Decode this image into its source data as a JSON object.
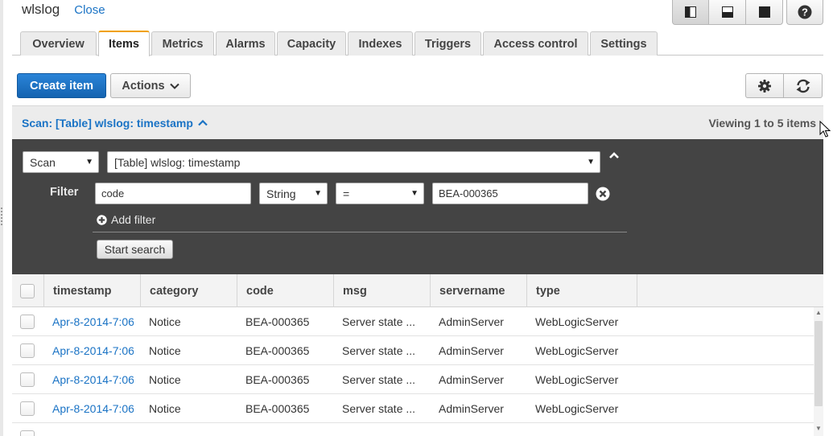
{
  "header": {
    "table_name": "wlslog",
    "close_label": "Close",
    "view_buttons": [
      {
        "name": "split-left-view-icon",
        "active": true
      },
      {
        "name": "split-bottom-view-icon",
        "active": false
      },
      {
        "name": "full-view-icon",
        "active": false
      }
    ],
    "help_icon": "help-icon"
  },
  "tabs": [
    {
      "label": "Overview",
      "active": false
    },
    {
      "label": "Items",
      "active": true
    },
    {
      "label": "Metrics",
      "active": false
    },
    {
      "label": "Alarms",
      "active": false
    },
    {
      "label": "Capacity",
      "active": false
    },
    {
      "label": "Indexes",
      "active": false
    },
    {
      "label": "Triggers",
      "active": false
    },
    {
      "label": "Access control",
      "active": false
    },
    {
      "label": "Settings",
      "active": false
    }
  ],
  "toolbar": {
    "create_label": "Create item",
    "actions_label": "Actions",
    "settings_icon": "gear-icon",
    "refresh_icon": "refresh-icon"
  },
  "scan": {
    "title": "Scan: [Table] wlslog: timestamp",
    "viewing": "Viewing 1 to 5 items",
    "mode": "Scan",
    "target": "[Table] wlslog: timestamp",
    "filter_label": "Filter",
    "filter": {
      "attribute": "code",
      "type": "String",
      "operator": "=",
      "value": "BEA-000365"
    },
    "add_filter_label": "Add filter",
    "start_label": "Start search"
  },
  "grid": {
    "columns": [
      "timestamp",
      "category",
      "code",
      "msg",
      "servername",
      "type"
    ],
    "rows": [
      {
        "timestamp": "Apr-8-2014-7:06",
        "category": "Notice",
        "code": "BEA-000365",
        "msg": "Server state ...",
        "servername": "AdminServer",
        "type": "WebLogicServer"
      },
      {
        "timestamp": "Apr-8-2014-7:06",
        "category": "Notice",
        "code": "BEA-000365",
        "msg": "Server state ...",
        "servername": "AdminServer",
        "type": "WebLogicServer"
      },
      {
        "timestamp": "Apr-8-2014-7:06",
        "category": "Notice",
        "code": "BEA-000365",
        "msg": "Server state ...",
        "servername": "AdminServer",
        "type": "WebLogicServer"
      },
      {
        "timestamp": "Apr-8-2014-7:06",
        "category": "Notice",
        "code": "BEA-000365",
        "msg": "Server state ...",
        "servername": "AdminServer",
        "type": "WebLogicServer"
      }
    ]
  },
  "colors": {
    "link": "#1a73c5",
    "primary": "#1e73c6",
    "active_tab_accent": "#f0a000",
    "panel_bg": "#444444"
  }
}
